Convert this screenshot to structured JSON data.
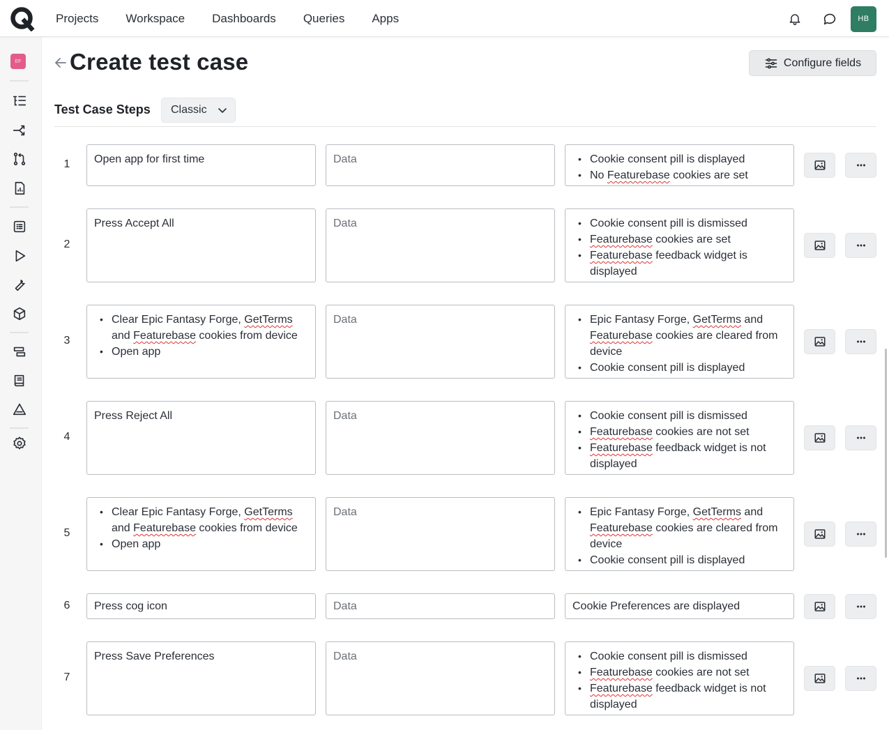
{
  "nav": {
    "items": [
      "Projects",
      "Workspace",
      "Dashboards",
      "Queries",
      "Apps"
    ]
  },
  "user": {
    "initials": "HB"
  },
  "sidebar": {
    "project_badge": "EF"
  },
  "header": {
    "title": "Create test case",
    "configure_label": "Configure fields"
  },
  "steps_section": {
    "label": "Test Case Steps",
    "mode": "Classic"
  },
  "data_placeholder": "Data",
  "steps": [
    {
      "number": "1",
      "action": {
        "text": "Open app for first time"
      },
      "expected": {
        "bullets": [
          "Cookie consent pill is displayed",
          "No Featurebase cookies are set"
        ]
      }
    },
    {
      "number": "2",
      "action": {
        "text": "Press Accept All"
      },
      "expected": {
        "bullets": [
          "Cookie consent pill is dismissed",
          "Featurebase cookies are set",
          "Featurebase feedback widget is displayed"
        ]
      }
    },
    {
      "number": "3",
      "action": {
        "bullets": [
          "Clear Epic Fantasy Forge, GetTerms and Featurebase cookies from device",
          "Open app"
        ]
      },
      "expected": {
        "bullets": [
          "Epic Fantasy Forge, GetTerms and Featurebase cookies are cleared from device",
          "Cookie consent pill is displayed"
        ]
      }
    },
    {
      "number": "4",
      "action": {
        "text": "Press Reject All"
      },
      "expected": {
        "bullets": [
          "Cookie consent pill is dismissed",
          "Featurebase cookies are not set",
          "Featurebase feedback widget is not displayed"
        ]
      }
    },
    {
      "number": "5",
      "action": {
        "bullets": [
          "Clear Epic Fantasy Forge, GetTerms and Featurebase cookies from device",
          "Open app"
        ]
      },
      "expected": {
        "bullets": [
          "Epic Fantasy Forge, GetTerms and Featurebase cookies are cleared from device",
          "Cookie consent pill is displayed"
        ]
      }
    },
    {
      "number": "6",
      "action": {
        "text": "Press cog icon"
      },
      "expected": {
        "text": "Cookie Preferences are displayed"
      }
    },
    {
      "number": "7",
      "action": {
        "text": "Press Save Preferences"
      },
      "expected": {
        "bullets": [
          "Cookie consent pill is dismissed",
          "Featurebase cookies are not set",
          "Featurebase feedback widget is not displayed"
        ]
      }
    }
  ]
}
